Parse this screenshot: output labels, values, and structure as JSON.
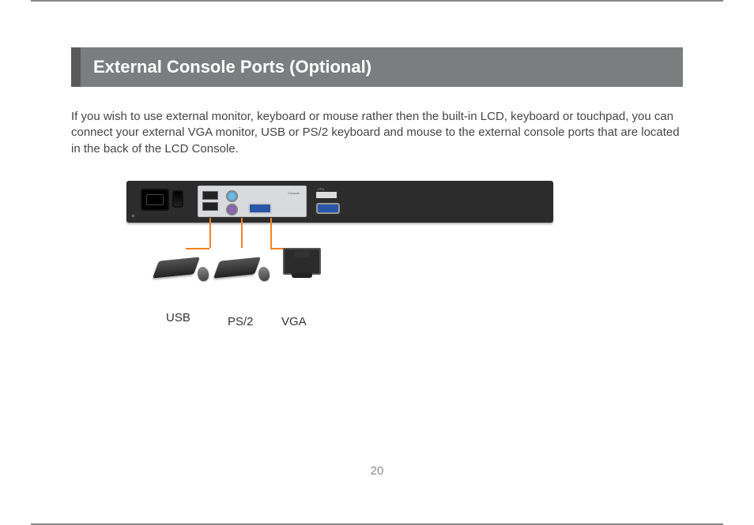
{
  "title": "External Console Ports (Optional)",
  "intro": "If you wish to use external monitor, keyboard or mouse rather then the built-in LCD, keyboard or touchpad, you can connect your external VGA monitor, USB or PS/2 keyboard and mouse to the external console ports that are located in the back of the LCD Console.",
  "diagram": {
    "panel_label_console": "Console",
    "panel_label_cpu": "CPU",
    "labels": {
      "usb": "USB",
      "ps2": "PS/2",
      "vga": "VGA"
    }
  },
  "page_number": "20"
}
